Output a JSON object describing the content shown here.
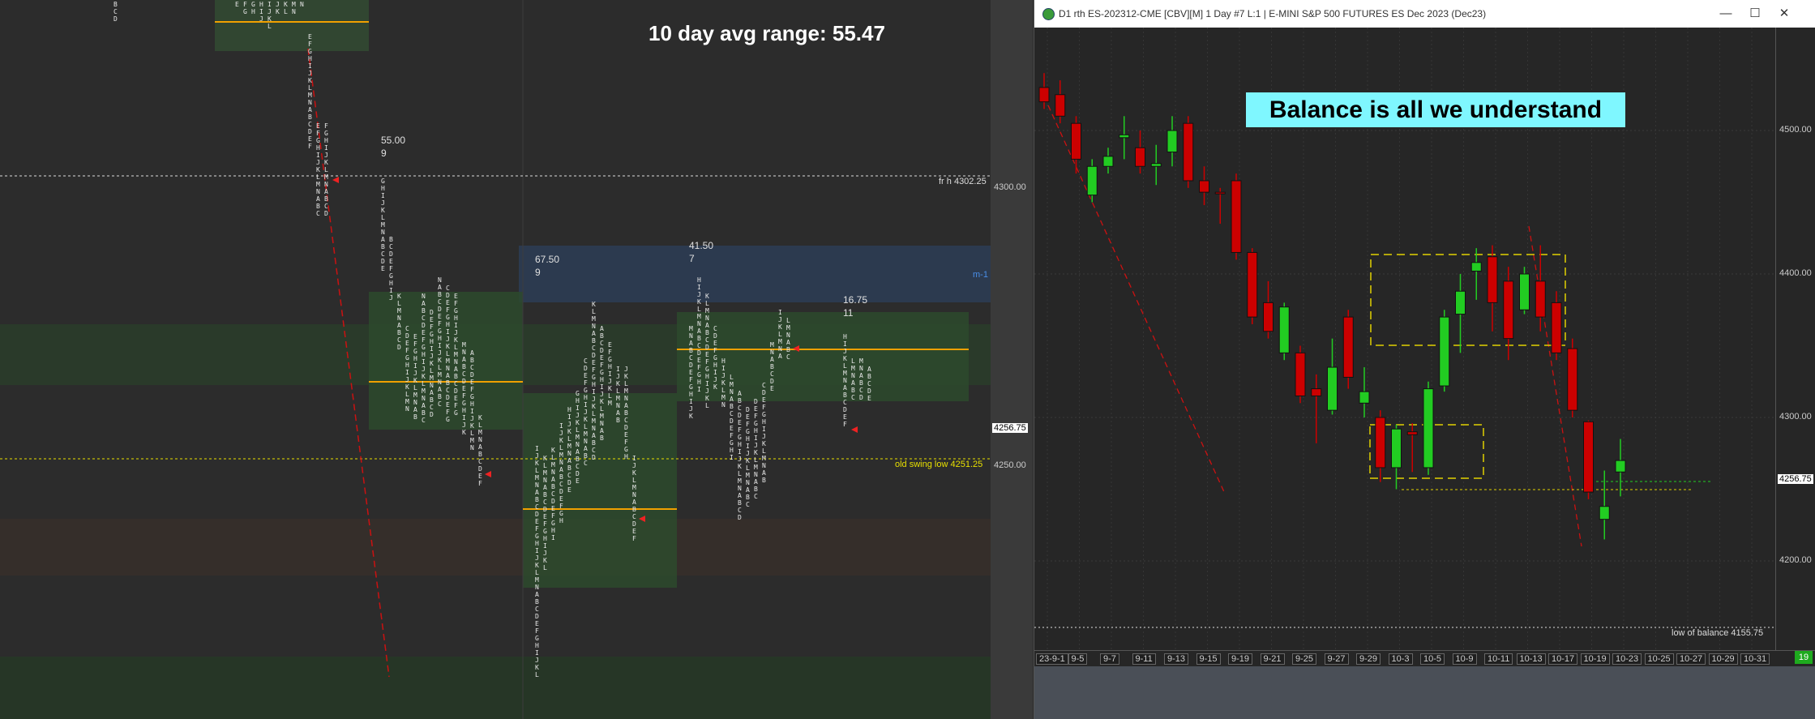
{
  "left_chart": {
    "avg_range_text": "10 day avg range:  55.47",
    "session_labels": [
      {
        "range": "55.00",
        "count": "9"
      },
      {
        "range": "67.50",
        "count": "9"
      },
      {
        "range": "41.50",
        "count": "7"
      },
      {
        "range": "16.75",
        "count": "11"
      }
    ],
    "line_labels": {
      "frh": "fr h  4302.25",
      "old_swing_low": "old swing low  4251.25",
      "m1": "m-1"
    },
    "axis": {
      "p4300": "4300.00",
      "p4256": "4256.75",
      "p4250": "4250.00"
    }
  },
  "right_window": {
    "title": "D1 rth ES-202312-CME [CBV][M]  1 Day  #7 L:1 | E-MINI S&P 500 FUTURES ES Dec 2023 (Dec23)",
    "controls": [
      "—",
      "☐",
      "✕"
    ],
    "banner": "Balance is all we understand",
    "low_of_balance": "low of balance  4155.75",
    "price_axis": [
      "4500.00",
      "4400.00",
      "4300.00",
      "4256.75",
      "4200.00"
    ],
    "date_labels": [
      "23-9-1",
      "9-5",
      "9-7",
      "9-11",
      "9-13",
      "9-15",
      "9-19",
      "9-21",
      "9-25",
      "9-27",
      "9-29",
      "10-3",
      "10-5",
      "10-9",
      "10-11",
      "10-13",
      "10-17",
      "10-19",
      "10-23",
      "10-25",
      "10-27",
      "10-29",
      "10-31"
    ],
    "badge": "19",
    "candles": [
      {
        "o": 4530,
        "c": 4520,
        "h": 4540,
        "l": 4515
      },
      {
        "o": 4525,
        "c": 4510,
        "h": 4535,
        "l": 4505
      },
      {
        "o": 4505,
        "c": 4480,
        "h": 4510,
        "l": 4470
      },
      {
        "o": 4455,
        "c": 4475,
        "h": 4480,
        "l": 4450
      },
      {
        "o": 4475,
        "c": 4482,
        "h": 4488,
        "l": 4470
      },
      {
        "o": 4495,
        "c": 4497,
        "h": 4510,
        "l": 4480
      },
      {
        "o": 4488,
        "c": 4475,
        "h": 4500,
        "l": 4470
      },
      {
        "o": 4475,
        "c": 4477,
        "h": 4490,
        "l": 4462
      },
      {
        "o": 4485,
        "c": 4500,
        "h": 4510,
        "l": 4475
      },
      {
        "o": 4505,
        "c": 4465,
        "h": 4510,
        "l": 4460
      },
      {
        "o": 4465,
        "c": 4457,
        "h": 4475,
        "l": 4448
      },
      {
        "o": 4457,
        "c": 4456,
        "h": 4460,
        "l": 4435
      },
      {
        "o": 4465,
        "c": 4415,
        "h": 4470,
        "l": 4410
      },
      {
        "o": 4415,
        "c": 4370,
        "h": 4418,
        "l": 4365
      },
      {
        "o": 4380,
        "c": 4360,
        "h": 4395,
        "l": 4355
      },
      {
        "o": 4345,
        "c": 4377,
        "h": 4380,
        "l": 4340
      },
      {
        "o": 4345,
        "c": 4315,
        "h": 4350,
        "l": 4310
      },
      {
        "o": 4320,
        "c": 4315,
        "h": 4330,
        "l": 4282
      },
      {
        "o": 4305,
        "c": 4335,
        "h": 4355,
        "l": 4302
      },
      {
        "o": 4370,
        "c": 4328,
        "h": 4375,
        "l": 4320
      },
      {
        "o": 4310,
        "c": 4318,
        "h": 4335,
        "l": 4300
      },
      {
        "o": 4300,
        "c": 4265,
        "h": 4305,
        "l": 4255
      },
      {
        "o": 4265,
        "c": 4292,
        "h": 4295,
        "l": 4250
      },
      {
        "o": 4290,
        "c": 4288,
        "h": 4296,
        "l": 4262
      },
      {
        "o": 4265,
        "c": 4320,
        "h": 4325,
        "l": 4260
      },
      {
        "o": 4322,
        "c": 4370,
        "h": 4375,
        "l": 4318
      },
      {
        "o": 4372,
        "c": 4388,
        "h": 4400,
        "l": 4345
      },
      {
        "o": 4402,
        "c": 4408,
        "h": 4418,
        "l": 4382
      },
      {
        "o": 4412,
        "c": 4380,
        "h": 4420,
        "l": 4360
      },
      {
        "o": 4395,
        "c": 4355,
        "h": 4405,
        "l": 4340
      },
      {
        "o": 4375,
        "c": 4400,
        "h": 4405,
        "l": 4372
      },
      {
        "o": 4395,
        "c": 4370,
        "h": 4420,
        "l": 4360
      },
      {
        "o": 4380,
        "c": 4345,
        "h": 4388,
        "l": 4340
      },
      {
        "o": 4348,
        "c": 4305,
        "h": 4355,
        "l": 4300
      },
      {
        "o": 4297,
        "c": 4248,
        "h": 4298,
        "l": 4243
      },
      {
        "o": 4229,
        "c": 4238,
        "h": 4263,
        "l": 4215
      },
      {
        "o": 4262,
        "c": 4270,
        "h": 4285,
        "l": 4245
      }
    ]
  },
  "colors": {
    "up": "#22cc22",
    "down": "#cc0000",
    "balance_box": "#e0d000",
    "banner_bg": "#7ff7ff"
  }
}
